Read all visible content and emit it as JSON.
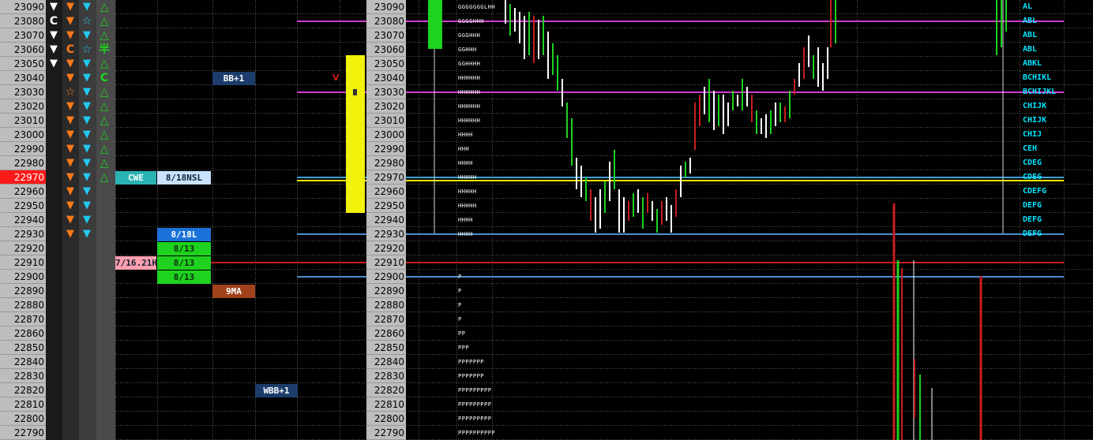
{
  "ladder": {
    "prices": [
      "23090",
      "23080",
      "23070",
      "23060",
      "23050",
      "23040",
      "23030",
      "23020",
      "23010",
      "23000",
      "22990",
      "22980",
      "22970",
      "22960",
      "22950",
      "22940",
      "22930",
      "22920",
      "22910",
      "22900",
      "22890",
      "22880",
      "22870",
      "22860",
      "22850",
      "22840",
      "22830",
      "22820",
      "22810",
      "22800",
      "22790"
    ],
    "current_price": "22970"
  },
  "icon_columns": {
    "white_down": [
      "tri-down",
      "C",
      "tri-down",
      "tri-down",
      "tri-down",
      "",
      "",
      "",
      "",
      "",
      "",
      "",
      "",
      "",
      "",
      "",
      "",
      "",
      "",
      "",
      "",
      "",
      "",
      "",
      "",
      "",
      "",
      "",
      "",
      "",
      ""
    ],
    "orange": [
      "tri-down",
      "tri-down",
      "tri-down",
      "C",
      "tri-down",
      "tri-down",
      "star",
      "tri-down",
      "tri-down",
      "tri-down",
      "tri-down",
      "tri-down",
      "tri-down",
      "tri-down",
      "tri-down",
      "tri-down",
      "tri-down",
      "",
      "",
      "",
      "",
      "",
      "",
      "",
      "",
      "",
      "",
      "",
      "",
      "",
      ""
    ],
    "cyan": [
      "tri-down",
      "star",
      "tri-down",
      "half",
      "tri-down",
      "tri-down",
      "tri-down",
      "tri-down",
      "tri-down",
      "tri-down",
      "tri-down",
      "tri-down",
      "tri-down",
      "tri-down",
      "tri-down",
      "tri-down",
      "tri-down",
      "",
      "",
      "",
      "",
      "",
      "",
      "",
      "",
      "",
      "",
      "",
      "",
      "",
      ""
    ],
    "green": [
      "tri-up",
      "tri-up",
      "tri-up",
      "yen",
      "tri-up",
      "C",
      "tri-up",
      "tri-up",
      "tri-up",
      "tri-up",
      "tri-up",
      "tri-up",
      "tri-up",
      "",
      "",
      "",
      "",
      "",
      "",
      "",
      "",
      "",
      "",
      "",
      "",
      "",
      "",
      "",
      "",
      "",
      ""
    ]
  },
  "tags": [
    {
      "label": "BB+1",
      "row": 5,
      "col": "c5",
      "color": "#1c3d6b"
    },
    {
      "label": "CWE",
      "row": 12,
      "col": "c2",
      "color": "#2ab3b3"
    },
    {
      "label": "8/18NSL",
      "row": 12,
      "col": "c3",
      "color": "#c9e3ff"
    },
    {
      "label": "8/18L",
      "row": 16,
      "col": "c3",
      "color": "#1a72d8"
    },
    {
      "label": "8/13",
      "row": 17,
      "col": "c3",
      "color": "#1fd21f"
    },
    {
      "label": "7/16.21H",
      "row": 18,
      "col": "c2",
      "color": "#ff9fb0"
    },
    {
      "label": "8/13",
      "row": 18,
      "col": "c3",
      "color": "#1fd21f"
    },
    {
      "label": "8/13",
      "row": 19,
      "col": "c3",
      "color": "#1fd21f"
    },
    {
      "label": "9MA",
      "row": 20,
      "col": "c4",
      "color": "#a0421b"
    },
    {
      "label": "WBB+1",
      "row": 27,
      "col": "c6",
      "color": "#1c3d6b"
    }
  ],
  "marker": {
    "label": "V"
  },
  "tpo_profile": [
    "GGGGGGGLHH",
    "GGGGHHH",
    "GGGHHH",
    "GGHHH",
    "GGHHHH",
    "HHHHHH",
    "HHHHHH",
    "HHHHHH",
    "HHHHHH",
    "HHHH",
    "HHH",
    "HHHH",
    "HHHHH",
    "HHHHH",
    "HHHHH",
    "HHHH",
    "HHHH",
    "",
    "",
    "P",
    "P",
    "P",
    "P",
    "PP",
    "PPP",
    "PPPPPPP",
    "PPPPPPP",
    "PPPPPPPPP",
    "PPPPPPPPP",
    "PPPPPPPPP",
    "PPPPPPPPPP"
  ],
  "right_labels": [
    "AL",
    "ABL",
    "ABL",
    "ABL",
    "ABKL",
    "BCHIKL",
    "BCHIJKL",
    "CHIJK",
    "CHIJK",
    "CHIJ",
    "CEH",
    "CDEG",
    "CDEG",
    "CDEFG",
    "DEFG",
    "DEFG",
    "DEFG",
    "",
    "",
    "",
    "",
    "",
    "",
    "",
    "",
    "",
    "",
    "",
    "",
    "",
    ""
  ],
  "colors": {
    "magenta": "#d23cd2",
    "yellow": "#f2f20a",
    "lightblue": "#4a90d0",
    "red": "#c81e1e",
    "green": "#1fd21f",
    "white": "#ffffff"
  }
}
